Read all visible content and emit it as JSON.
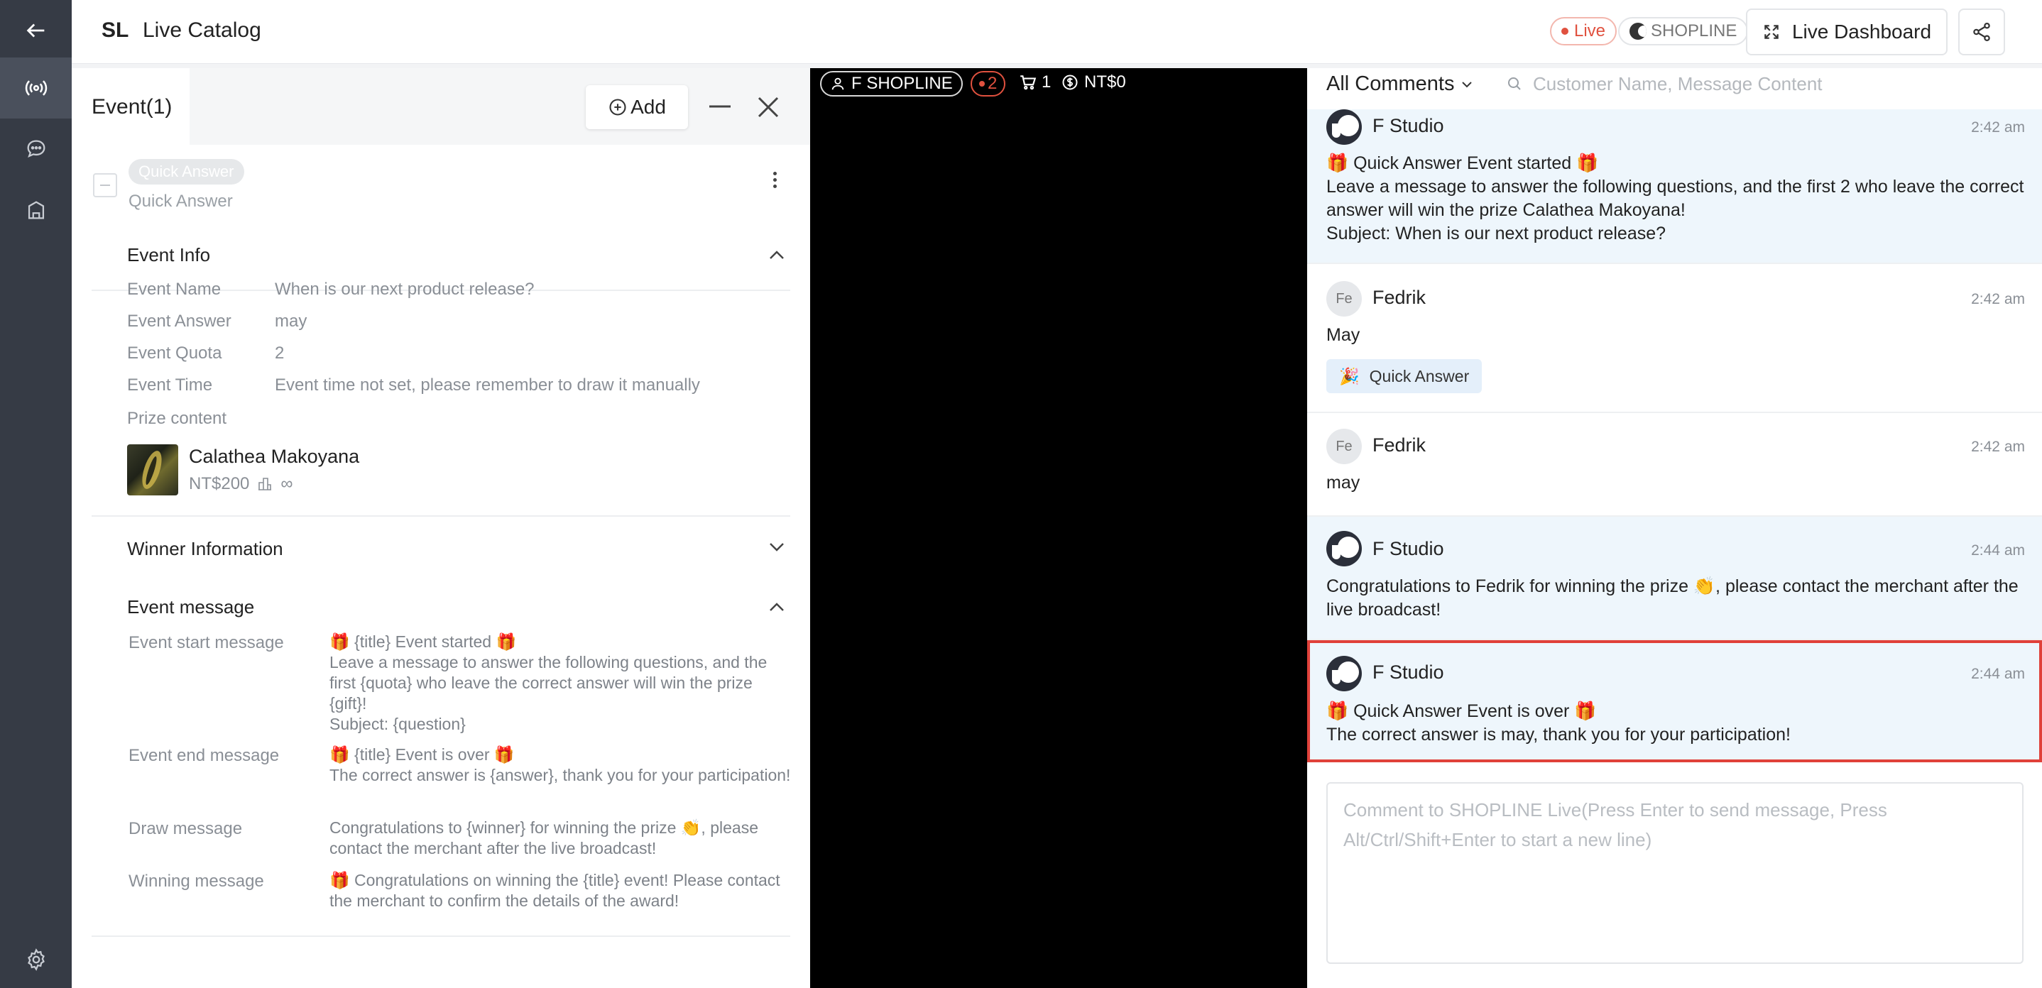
{
  "header": {
    "brand_code": "SL",
    "title": "Live Catalog",
    "live_label": "Live",
    "shop_label": "SHOPLINE",
    "dashboard_label": "Live Dashboard"
  },
  "event_panel": {
    "title": "Event(1)",
    "add_label": "Add",
    "event_tag": "Quick Answer",
    "event_type": "Quick Answer",
    "info_title": "Event Info",
    "fields": [
      {
        "label": "Event Name",
        "value": "When is our next product release?"
      },
      {
        "label": "Event Answer",
        "value": "may"
      },
      {
        "label": "Event Quota",
        "value": "2"
      },
      {
        "label": "Event Time",
        "value": "Event time not set, please remember to draw it manually"
      }
    ],
    "prize_label": "Prize content",
    "prize": {
      "name": "Calathea Makoyana",
      "price": "NT$200",
      "stock": "∞"
    },
    "winner_title": "Winner Information",
    "message_title": "Event message",
    "messages": [
      {
        "label": "Event start message",
        "value": "🎁 {title} Event started 🎁\nLeave a message to answer the following questions, and the first {quota} who leave the correct answer will win the prize {gift}!\nSubject: {question}"
      },
      {
        "label": "Event end message",
        "value": "🎁 {title} Event is over 🎁\nThe correct answer is {answer}, thank you for your participation!"
      },
      {
        "label": "Draw message",
        "value": "Congratulations to {winner} for winning the prize 👏, please contact the merchant after the live broadcast!"
      },
      {
        "label": "Winning message",
        "value": "🎁 Congratulations on winning the {title} event! Please contact the merchant to confirm the details of the award!"
      }
    ]
  },
  "video": {
    "user": "F SHOPLINE",
    "viewers": "2",
    "cart": "1",
    "amount": "NT$0"
  },
  "comments": {
    "filter_label": "All Comments",
    "search_placeholder": "Customer Name, Message Content",
    "items": [
      {
        "name": "F Studio",
        "time": "2:42 am",
        "text": "🎁 Quick Answer Event started 🎁\nLeave a message to answer the following questions, and the first 2 who leave the correct answer will win the prize Calathea Makoyana!\nSubject: When is our next product release?"
      },
      {
        "name": "Fedrik",
        "avatar": "Fe",
        "time": "2:42 am",
        "text": "May",
        "badge": "Quick Answer"
      },
      {
        "name": "Fedrik",
        "avatar": "Fe",
        "time": "2:42 am",
        "text": "may"
      },
      {
        "name": "F Studio",
        "time": "2:44 am",
        "text": "Congratulations to Fedrik for winning the prize 👏, please contact the merchant after the live broadcast!"
      },
      {
        "name": "F Studio",
        "time": "2:44 am",
        "text": "🎁 Quick Answer Event is over 🎁\nThe correct answer is may, thank you for your participation!"
      }
    ],
    "input_placeholder": "Comment to SHOPLINE Live(Press Enter to send message, Press Alt/Ctrl/Shift+Enter to start a new line)"
  }
}
